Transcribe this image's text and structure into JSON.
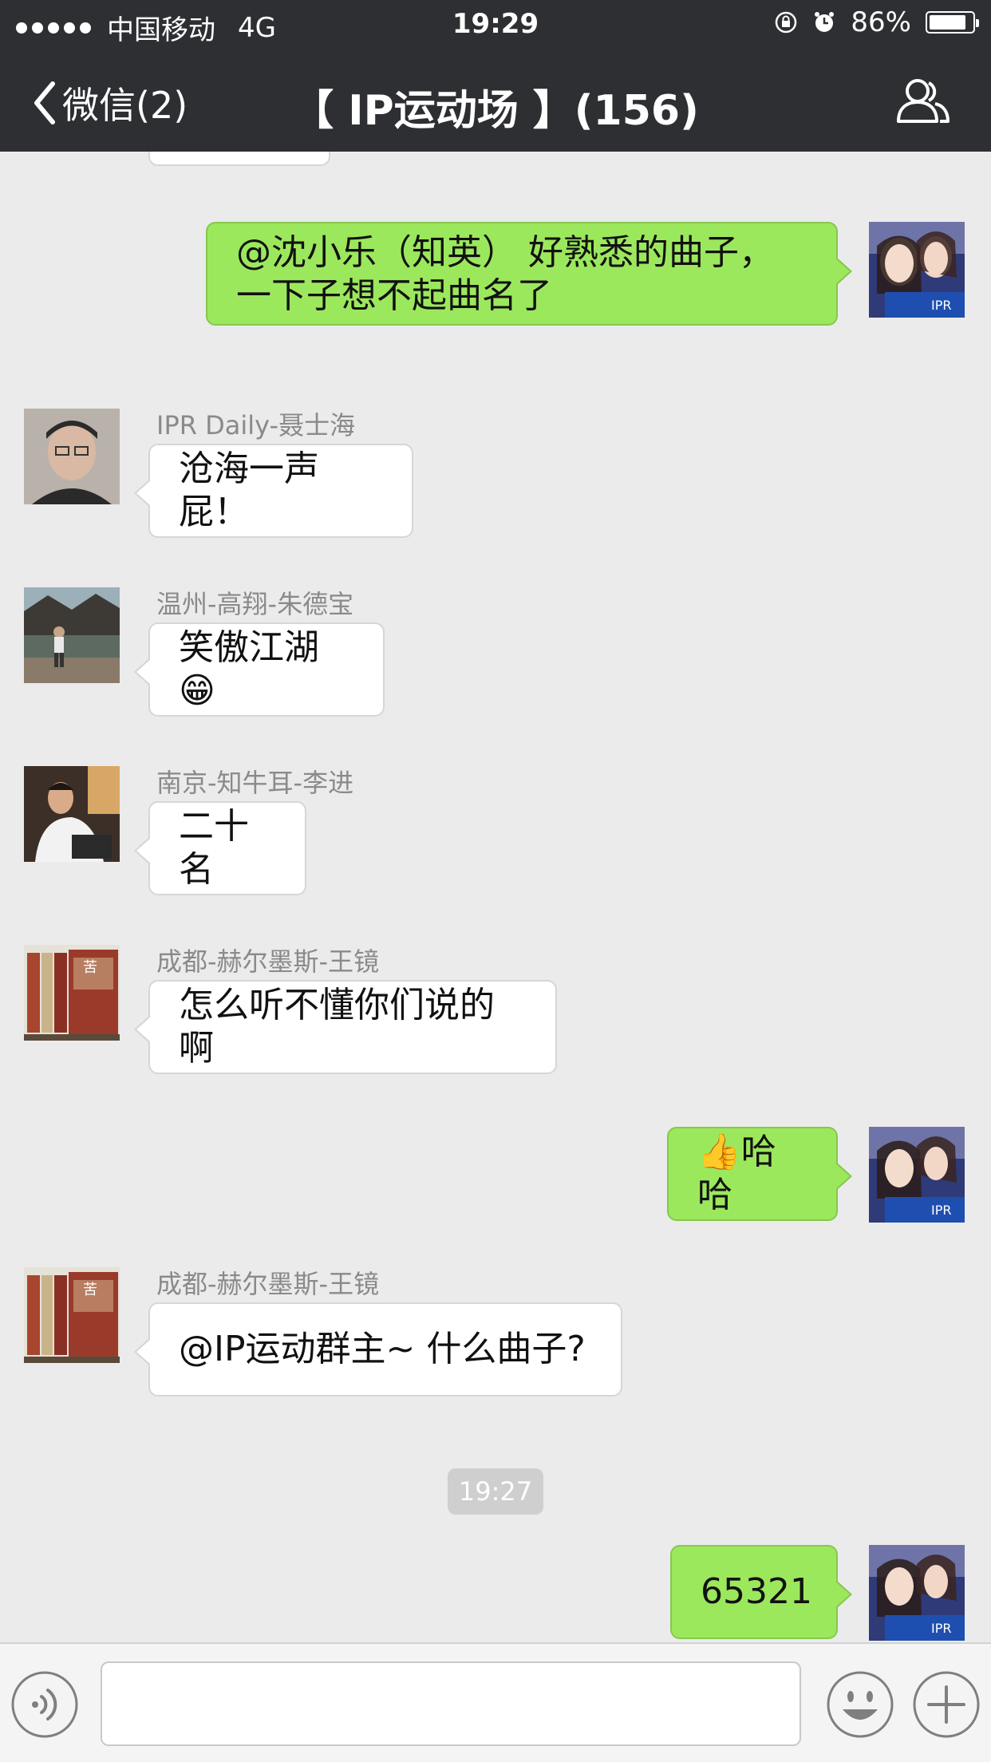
{
  "status_bar": {
    "carrier": "中国移动",
    "network": "4G",
    "time": "19:29",
    "battery_percent": "86%",
    "battery_level": 0.86
  },
  "nav": {
    "back_label": "微信(2)",
    "title": "【 IP运动场 】(156)"
  },
  "messages": [
    {
      "type": "outgoing",
      "text_lines": [
        "@沈小乐（知英）   好熟悉的曲子，",
        "一下子想不起曲名了"
      ]
    },
    {
      "type": "incoming",
      "sender": "IPR Daily-聂士海",
      "text": "沧海一声屁！"
    },
    {
      "type": "incoming",
      "sender": "温州-高翔-朱德宝",
      "text": "笑傲江湖😁"
    },
    {
      "type": "incoming",
      "sender": "南京-知牛耳-李进",
      "text": "二十名"
    },
    {
      "type": "incoming",
      "sender": "成都-赫尔墨斯-王镜",
      "text": "怎么听不懂你们说的啊"
    },
    {
      "type": "outgoing",
      "text": "👍哈哈"
    },
    {
      "type": "incoming",
      "sender": "成都-赫尔墨斯-王镜",
      "text": "@IP运动群主~ 什么曲子?"
    },
    {
      "type": "timestamp",
      "text": "19:27"
    },
    {
      "type": "outgoing",
      "text": "65321"
    }
  ],
  "colors": {
    "header_bg": "#2e2f33",
    "chat_bg": "#ebebeb",
    "outgoing_bubble": "#9ce85d",
    "incoming_bubble": "#ffffff"
  },
  "icons": {
    "back": "chevron-left-icon",
    "group": "group-members-icon",
    "voice": "voice-icon",
    "emoji": "emoji-icon",
    "more": "plus-icon"
  }
}
